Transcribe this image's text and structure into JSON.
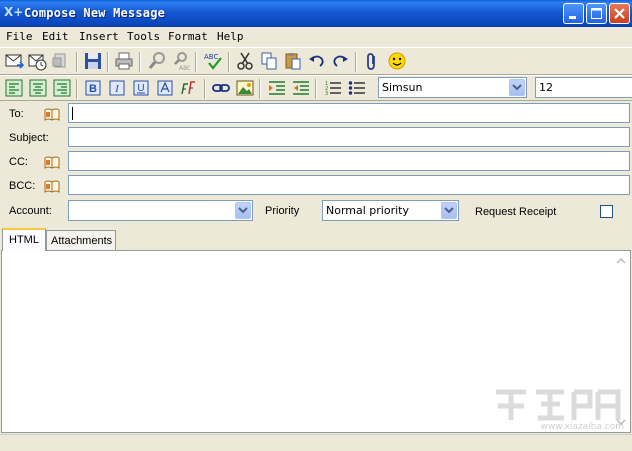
{
  "window": {
    "title": "Compose New Message",
    "app_icon": "X+",
    "controls": [
      "minimize-icon",
      "maximize-icon",
      "close-icon"
    ]
  },
  "menu": [
    "File",
    "Edit",
    "Insert",
    "Tools",
    "Format",
    "Help"
  ],
  "toolbar1": {
    "icons": [
      "new-message-icon",
      "send-later-icon",
      "attach-doc-icon",
      "save-icon",
      "print-icon",
      "find-icon",
      "replace-icon",
      "spellcheck-icon",
      "cut-icon",
      "copy-icon",
      "paste-icon",
      "undo-icon",
      "redo-icon",
      "paperclip-icon",
      "smiley-icon"
    ]
  },
  "toolbar2": {
    "icons": [
      "align-left-icon",
      "align-center-icon",
      "align-right-icon",
      "bold-icon",
      "italic-icon",
      "underline-icon",
      "highlight-icon",
      "font-icon",
      "link-icon",
      "image-icon",
      "indent-icon",
      "outdent-icon",
      "numbered-list-icon",
      "bullet-list-icon"
    ],
    "bold_glyph": "B",
    "italic_glyph": "I",
    "underline_glyph": "U",
    "font_name": "Simsun",
    "font_size": "12"
  },
  "fields": {
    "to_label": "To:",
    "to_value": "",
    "subject_label": "Subject:",
    "subject_value": "",
    "cc_label": "CC:",
    "cc_value": "",
    "bcc_label": "BCC:",
    "bcc_value": ""
  },
  "options": {
    "account_label": "Account:",
    "account_value": "",
    "priority_label": "Priority",
    "priority_value": "Normal priority",
    "receipt_label": "Request Receipt",
    "receipt_checked": false
  },
  "tabs": [
    "HTML",
    "Attachments"
  ],
  "active_tab": "HTML",
  "watermark": {
    "text": "www.xiazaiba.com"
  },
  "colors": {
    "titlebar": "#0b4fcc",
    "close_button": "#d6532c",
    "active_tab_accent": "#ffc83c",
    "field_border": "#7f9db9"
  }
}
